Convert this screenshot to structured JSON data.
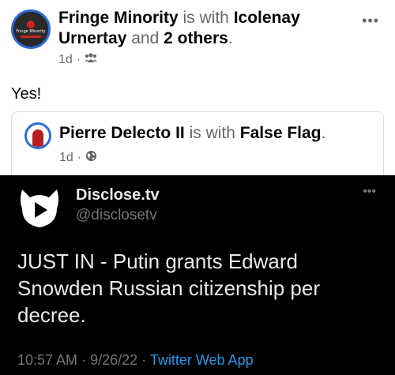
{
  "post": {
    "author": "Fringe Minority",
    "with_word": "is with",
    "tagged": "Icolenay Urnertay",
    "and_word": "and",
    "others": "2 others",
    "period": ".",
    "time": "1d",
    "sep": "·",
    "audience_icon": "friends-icon",
    "avatar_text": "Fringe Minority",
    "body": "Yes!"
  },
  "shared": {
    "author": "Pierre Delecto II",
    "with_word": "is with",
    "tagged": "False Flag",
    "period": ".",
    "time": "1d",
    "sep": "·",
    "audience_icon": "globe-icon"
  },
  "tweet": {
    "name": "Disclose.tv",
    "handle": "@disclosetv",
    "text": "JUST IN - Putin grants Edward Snowden Russian citizenship per decree.",
    "time": "10:57 AM",
    "sep1": "·",
    "date": "9/26/22",
    "sep2": "·",
    "app": "Twitter Web App"
  },
  "colors": {
    "facebook_text": "#050505",
    "facebook_muted": "#65676b",
    "avatar_ring": "#2e6bd6",
    "tweet_bg": "#000000",
    "twitter_blue": "#1d9bf0"
  }
}
